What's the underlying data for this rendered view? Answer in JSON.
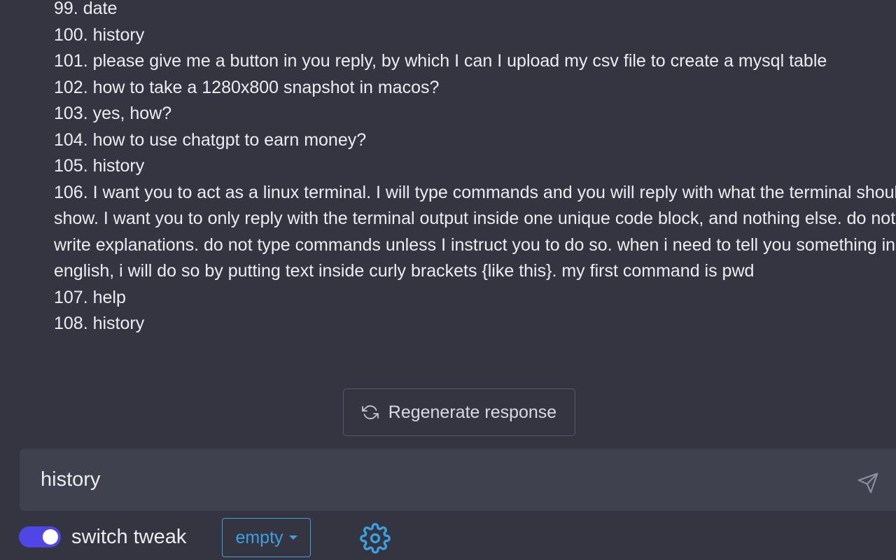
{
  "conversation": {
    "history_lines": [
      "99. date",
      "100. history",
      "101. please give me a button in you reply, by which I can I upload my csv file to create a mysql table",
      "102. how to take a 1280x800 snapshot in macos?",
      "103. yes, how?",
      "104. how to use chatgpt to earn money?",
      "105. history",
      "106. I want you to act as a linux terminal. I will type commands and you will reply with what the terminal should",
      "show. I want you to only reply with the terminal output inside one unique code block, and nothing else. do not",
      "write explanations. do not type commands unless I instruct you to do so. when i need to tell you something in",
      "english, i will do so by putting text inside curly brackets {like this}. my first command is pwd",
      "107. help",
      "108. history"
    ]
  },
  "regenerate": {
    "label": "Regenerate response",
    "icon": "refresh-icon"
  },
  "input": {
    "value": "history",
    "send_icon": "send-icon"
  },
  "controls": {
    "toggle_label": "switch tweak",
    "toggle_on": true,
    "dropdown_value": "empty",
    "settings_icon": "gear-icon"
  },
  "colors": {
    "background": "#343541",
    "input_bg": "#40414f",
    "toggle_accent": "#4f46e5",
    "dropdown_accent": "#3aa2e4"
  }
}
